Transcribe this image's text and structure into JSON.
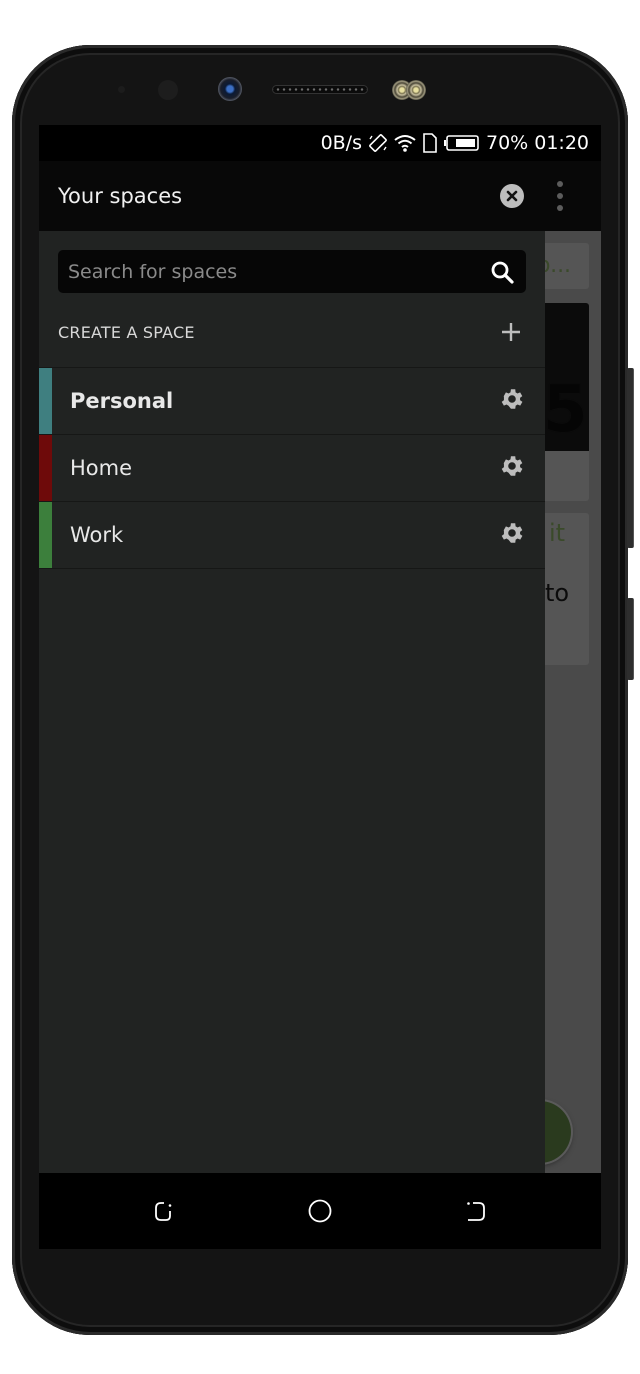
{
  "status_bar": {
    "network_speed": "0B/s",
    "icons": [
      "auto-rotate-icon",
      "wifi-icon",
      "sim-card-icon",
      "battery-icon"
    ],
    "battery_percent": "70%",
    "time": "01:20"
  },
  "header": {
    "title": "Your spaces",
    "close_icon": "close-circle-icon",
    "more_icon": "more-vertical-icon"
  },
  "search": {
    "placeholder": "Search for spaces",
    "value": "",
    "icon": "search-icon"
  },
  "create_space": {
    "label": "CREATE A SPACE",
    "icon": "plus-icon"
  },
  "spaces": [
    {
      "name": "Personal",
      "color": "#3f7f80",
      "active": true,
      "settings_icon": "gear-icon"
    },
    {
      "name": "Home",
      "color": "#6e0a0a",
      "active": false,
      "settings_icon": "gear-icon"
    },
    {
      "name": "Work",
      "color": "#3c7f3c",
      "active": false,
      "settings_icon": "gear-icon"
    }
  ],
  "background_app": {
    "card1_fragment": "o...",
    "card2_fragment": "5",
    "card3_fragment_1": "it",
    "card3_fragment_2": "to"
  },
  "nav_bar": {
    "buttons": [
      "recents-button",
      "home-button",
      "back-button"
    ]
  },
  "colors": {
    "drawer_bg": "#212322",
    "header_bg": "#080808",
    "search_bg": "#060606"
  }
}
